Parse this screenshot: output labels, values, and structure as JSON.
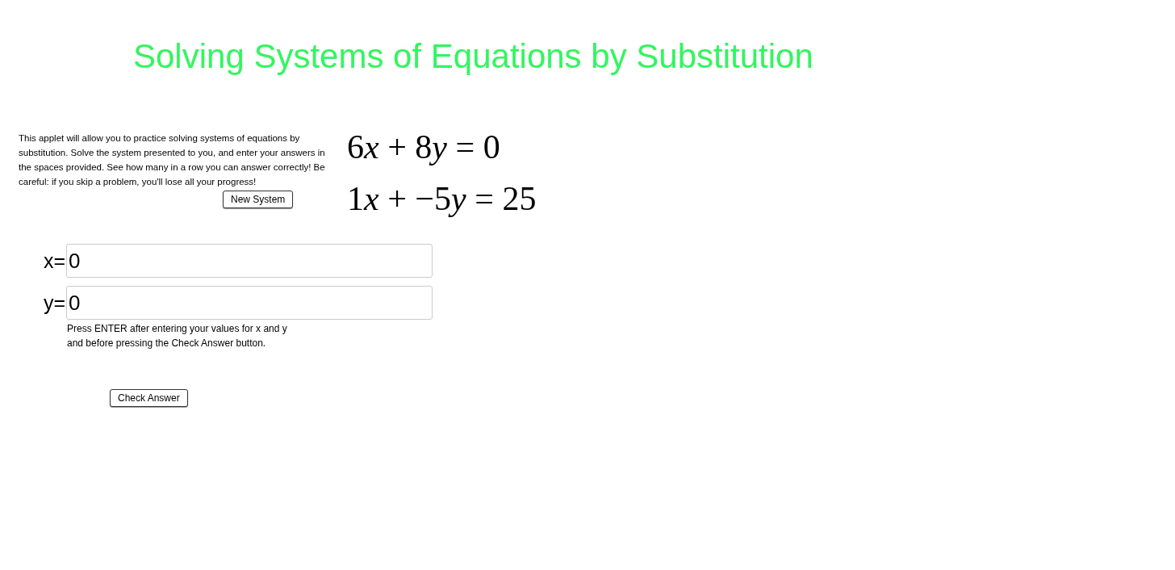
{
  "title": "Solving Systems of Equations by Substitution",
  "description": "This applet will allow you to practice solving systems of equations by substitution.  Solve the system presented to you, and enter your answers in the spaces provided.  See how many in a row you can answer correctly!  Be careful: if you skip a problem, you'll lose all your progress!",
  "new_system_button": "New System",
  "equations": [
    [
      {
        "kind": "num",
        "text": "6"
      },
      {
        "kind": "var",
        "text": "x"
      },
      {
        "kind": "op",
        "text": "+"
      },
      {
        "kind": "num",
        "text": "8"
      },
      {
        "kind": "var",
        "text": "y"
      },
      {
        "kind": "op",
        "text": "="
      },
      {
        "kind": "num",
        "text": "0"
      }
    ],
    [
      {
        "kind": "num",
        "text": "1"
      },
      {
        "kind": "var",
        "text": "x"
      },
      {
        "kind": "op",
        "text": "+"
      },
      {
        "kind": "num",
        "text": "−5"
      },
      {
        "kind": "var",
        "text": "y"
      },
      {
        "kind": "op",
        "text": "="
      },
      {
        "kind": "num",
        "text": "25"
      }
    ]
  ],
  "fields": [
    {
      "label": "x=",
      "value": "0"
    },
    {
      "label": "y=",
      "value": "0"
    }
  ],
  "note": [
    "Press ENTER after entering your values for x and y",
    "and before pressing the Check Answer button."
  ],
  "check_button": "Check Answer"
}
